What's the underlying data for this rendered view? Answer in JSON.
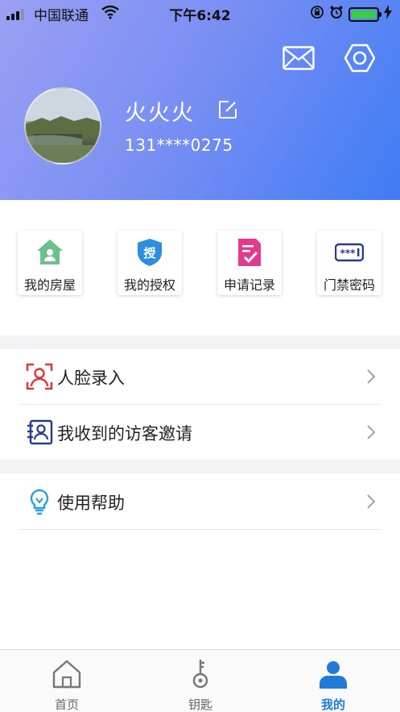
{
  "status_bar": {
    "carrier": "中国联通",
    "time": "下午6:42"
  },
  "profile": {
    "name": "火火火",
    "phone": "131****0275"
  },
  "quick_actions": [
    {
      "label": "我的房屋",
      "icon": "house-user-icon",
      "color": "#6cc08b"
    },
    {
      "label": "我的授权",
      "icon": "authorize-shield-icon",
      "color": "#2b8ee0"
    },
    {
      "label": "申请记录",
      "icon": "application-record-icon",
      "color": "#e23a8c"
    },
    {
      "label": "门禁密码",
      "icon": "password-keypad-icon",
      "color": "#2a3a8a"
    }
  ],
  "menu": [
    {
      "label": "人脸录入",
      "icon": "face-scan-icon"
    },
    {
      "label": "我收到的访客邀请",
      "icon": "visitor-invite-icon"
    },
    {
      "label": "使用帮助",
      "icon": "lightbulb-help-icon"
    }
  ],
  "tabs": [
    {
      "label": "首页",
      "icon": "home-icon",
      "active": false
    },
    {
      "label": "钥匙",
      "icon": "key-icon",
      "active": false
    },
    {
      "label": "我的",
      "icon": "user-icon",
      "active": true
    }
  ],
  "colors": {
    "header_gradient_start": "#9aa0f3",
    "header_gradient_end": "#3f7cf5",
    "active_tab": "#1f7ad8",
    "battery": "#3ccb4a"
  }
}
